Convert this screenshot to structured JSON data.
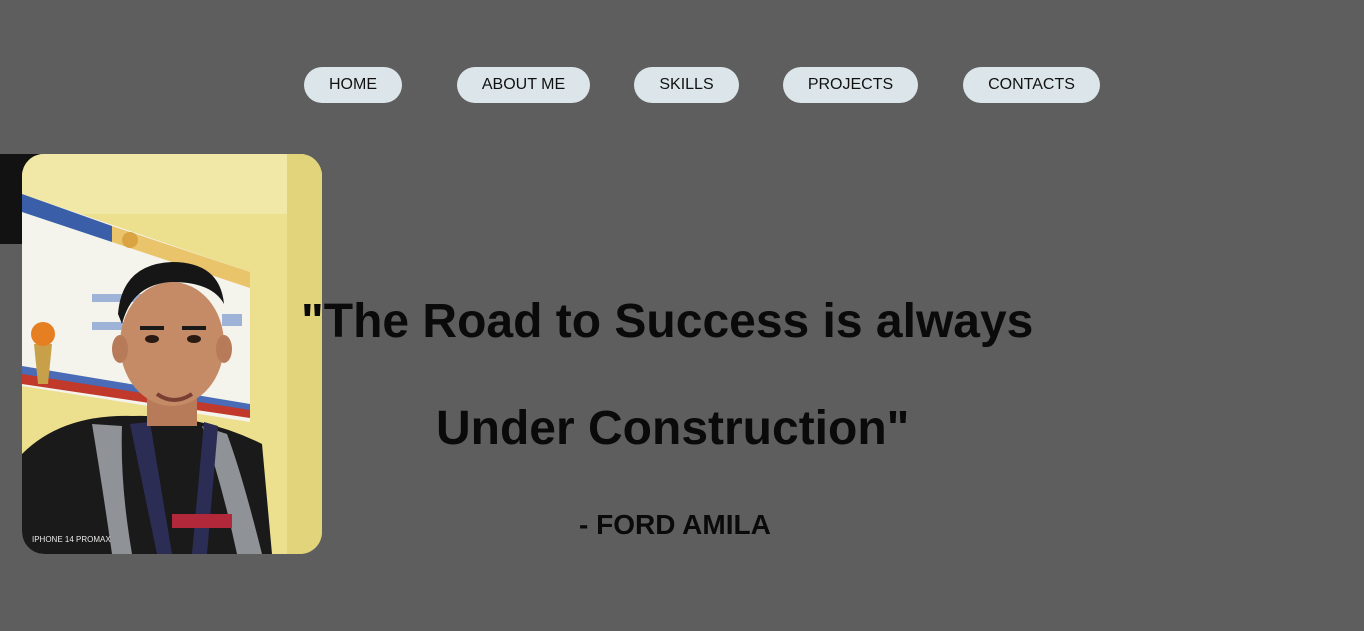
{
  "nav": {
    "items": [
      {
        "label": "HOME"
      },
      {
        "label": "ABOUT ME"
      },
      {
        "label": "SKILLS"
      },
      {
        "label": "PROJECTS"
      },
      {
        "label": "CONTACTS"
      }
    ]
  },
  "hero": {
    "quote_line_1": "\"The Road to Success is always",
    "quote_line_2": "Under Construction\"",
    "author": "- FORD AMILA"
  },
  "photo": {
    "watermark": "IPHONE 14 PROMAX"
  },
  "colors": {
    "background": "#5e5e5e",
    "nav_button": "#dce6ea",
    "text": "#0a0a0a"
  }
}
